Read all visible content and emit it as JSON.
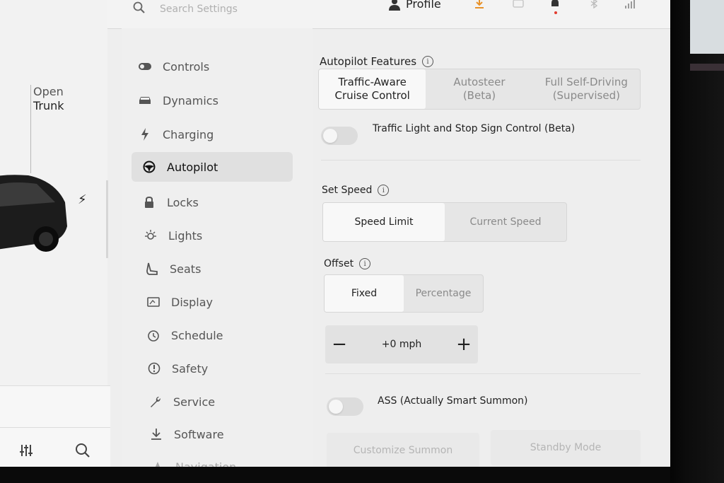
{
  "car": {
    "open_label": "Open",
    "trunk_label": "Trunk"
  },
  "topbar": {
    "search_placeholder": "Search Settings",
    "profile_label": "Profile"
  },
  "menu": {
    "items": [
      {
        "label": "Controls",
        "icon": "toggle-icon"
      },
      {
        "label": "Dynamics",
        "icon": "car-icon"
      },
      {
        "label": "Charging",
        "icon": "bolt-icon"
      },
      {
        "label": "Autopilot",
        "icon": "steering-wheel-icon",
        "active": true
      },
      {
        "label": "Locks",
        "icon": "lock-icon"
      },
      {
        "label": "Lights",
        "icon": "light-icon"
      },
      {
        "label": "Seats",
        "icon": "seat-icon"
      },
      {
        "label": "Display",
        "icon": "display-icon"
      },
      {
        "label": "Schedule",
        "icon": "clock-icon"
      },
      {
        "label": "Safety",
        "icon": "safety-icon"
      },
      {
        "label": "Service",
        "icon": "wrench-icon"
      },
      {
        "label": "Software",
        "icon": "download-icon"
      },
      {
        "label": "Navigation",
        "icon": "navigation-icon"
      }
    ]
  },
  "autopilot": {
    "features_label": "Autopilot Features",
    "features_options": [
      "Traffic-Aware\nCruise Control",
      "Autosteer\n(Beta)",
      "Full Self-Driving\n(Supervised)"
    ],
    "features_selected": 0,
    "traffic_light_label": "Traffic Light and Stop Sign Control (Beta)",
    "traffic_light_on": false,
    "set_speed_label": "Set Speed",
    "set_speed_options": [
      "Speed Limit",
      "Current Speed"
    ],
    "set_speed_selected": 0,
    "offset_label": "Offset",
    "offset_options": [
      "Fixed",
      "Percentage"
    ],
    "offset_selected": 0,
    "offset_minus": "−",
    "offset_value": "+0 mph",
    "offset_plus": "+",
    "ass_label": "ASS (Actually Smart Summon)",
    "ass_on": false,
    "customize_summon": "Customize Summon",
    "standby_mode": "Standby Mode"
  },
  "colors": {
    "background": "#eeeeee",
    "selected_segment": "#f8f8f8",
    "notification_dot": "#e23c2f"
  }
}
